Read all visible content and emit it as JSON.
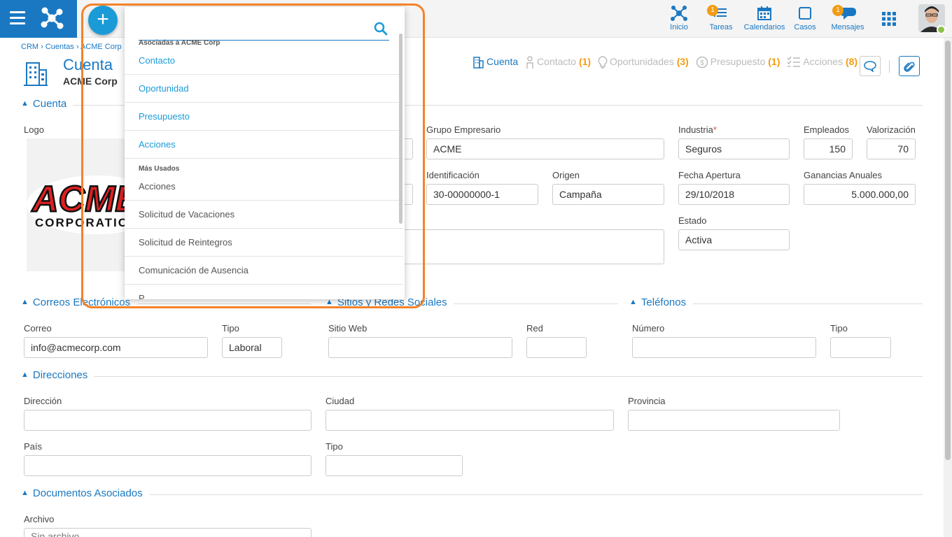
{
  "nav": {
    "inicio": "Inicio",
    "tareas": "Tareas",
    "tareas_badge": "1",
    "calendarios": "Calendarios",
    "casos": "Casos",
    "mensajes": "Mensajes",
    "mensajes_badge": "1"
  },
  "breadcrumb": "CRM › Cuentas › ACME Corp",
  "page": {
    "title": "Cuenta",
    "subtitle": "ACME Corp"
  },
  "related": {
    "cuenta": "Cuenta",
    "contacto": "Contacto",
    "contacto_count": "(1)",
    "oportunidades": "Oportunidades",
    "oportunidades_count": "(3)",
    "presupuesto": "Presupuesto",
    "presupuesto_count": "(1)",
    "acciones": "Acciones",
    "acciones_count": "(8)"
  },
  "sections": {
    "cuenta": "Cuenta",
    "correos": "Correos Electrónicos",
    "sitios": "Sitios y Redes Sociales",
    "telefonos": "Teléfonos",
    "direcciones": "Direcciones",
    "documentos": "Documentos Asociados"
  },
  "account": {
    "logo_label": "Logo",
    "logo_text_top": "ACME",
    "logo_text_bottom": "CORPORATION",
    "grupo_label": "Grupo Empresario",
    "grupo_value": "ACME",
    "industria_label": "Industria",
    "industria_req": "*",
    "industria_value": "Seguros",
    "empleados_label": "Empleados",
    "empleados_value": "150",
    "valorizacion_label": "Valorización",
    "valorizacion_value": "70",
    "identificacion_label": "Identificación",
    "identificacion_value": "30-00000000-1",
    "origen_label": "Origen",
    "origen_value": "Campaña",
    "fecha_label": "Fecha Apertura",
    "fecha_value": "29/10/2018",
    "ganancias_label": "Ganancias Anuales",
    "ganancias_value": "5.000.000,00",
    "estado_label": "Estado",
    "estado_value": "Activa"
  },
  "emails": {
    "correo_label": "Correo",
    "correo_value": "info@acmecorp.com",
    "tipo_label": "Tipo",
    "tipo_value": "Laboral"
  },
  "sites": {
    "sitio_label": "Sitio Web",
    "red_label": "Red"
  },
  "phones": {
    "numero_label": "Número",
    "tipo_label": "Tipo"
  },
  "addresses": {
    "direccion_label": "Dirección",
    "ciudad_label": "Ciudad",
    "provincia_label": "Provincia",
    "pais_label": "País",
    "tipo_label": "Tipo"
  },
  "documents": {
    "archivo_label": "Archivo",
    "archivo_value": "Sin archivo"
  },
  "dropdown": {
    "add_symbol": "+",
    "search_placeholder": "",
    "group_associated": "Asociadas a ACME Corp",
    "associated": [
      "Contacto",
      "Oportunidad",
      "Presupuesto",
      "Acciones"
    ],
    "group_used": "Más Usados",
    "used": [
      "Acciones",
      "Solicitud de Vacaciones",
      "Solicitud de Reintegros",
      "Comunicación de Ausencia",
      "P..."
    ]
  },
  "colors": {
    "primary": "#1a78c2",
    "accent": "#1a9bd7",
    "badge": "#f39c12",
    "highlight": "#f5822a"
  }
}
